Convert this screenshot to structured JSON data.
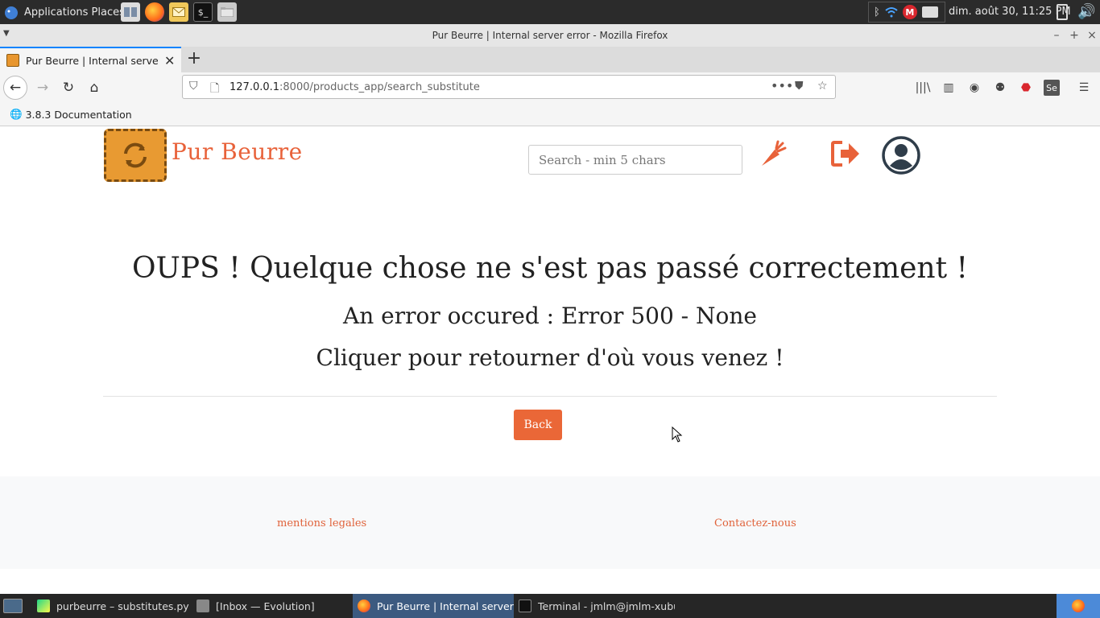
{
  "desktop": {
    "menu_label": "Applications Places",
    "clock": "dim. août 30, 11:25 PM"
  },
  "window": {
    "title": "Pur Beurre | Internal server error - Mozilla Firefox"
  },
  "browser": {
    "tab_title": "Pur Beurre | Internal server error",
    "url_host": "127.0.0.1",
    "url_rest": ":8000/products_app/search_substitute",
    "bookmark_label": "3.8.3 Documentation"
  },
  "site": {
    "brand": "Pur Beurre",
    "search_placeholder": "Search - min 5 chars"
  },
  "error": {
    "title": "OUPS ! Quelque chose ne s'est pas passé correctement !",
    "message": "An error occured : Error 500 - None",
    "hint": "Cliquer pour retourner d'où vous venez !",
    "back_label": "Back"
  },
  "footer": {
    "legal_label": "mentions legales",
    "contact_label": "Contactez-nous"
  },
  "taskbar": {
    "tasks": [
      {
        "label": "purbeurre – substitutes.py"
      },
      {
        "label": "[Inbox — Evolution]"
      },
      {
        "label": "Pur Beurre | Internal server..."
      },
      {
        "label": "Terminal - jmlm@jmlm-xubu..."
      }
    ]
  },
  "colors": {
    "brand_orange": "#e8623a",
    "button_orange": "#ea6737",
    "logo_fill": "#e89a32",
    "account_icon": "#2f3d4a"
  }
}
